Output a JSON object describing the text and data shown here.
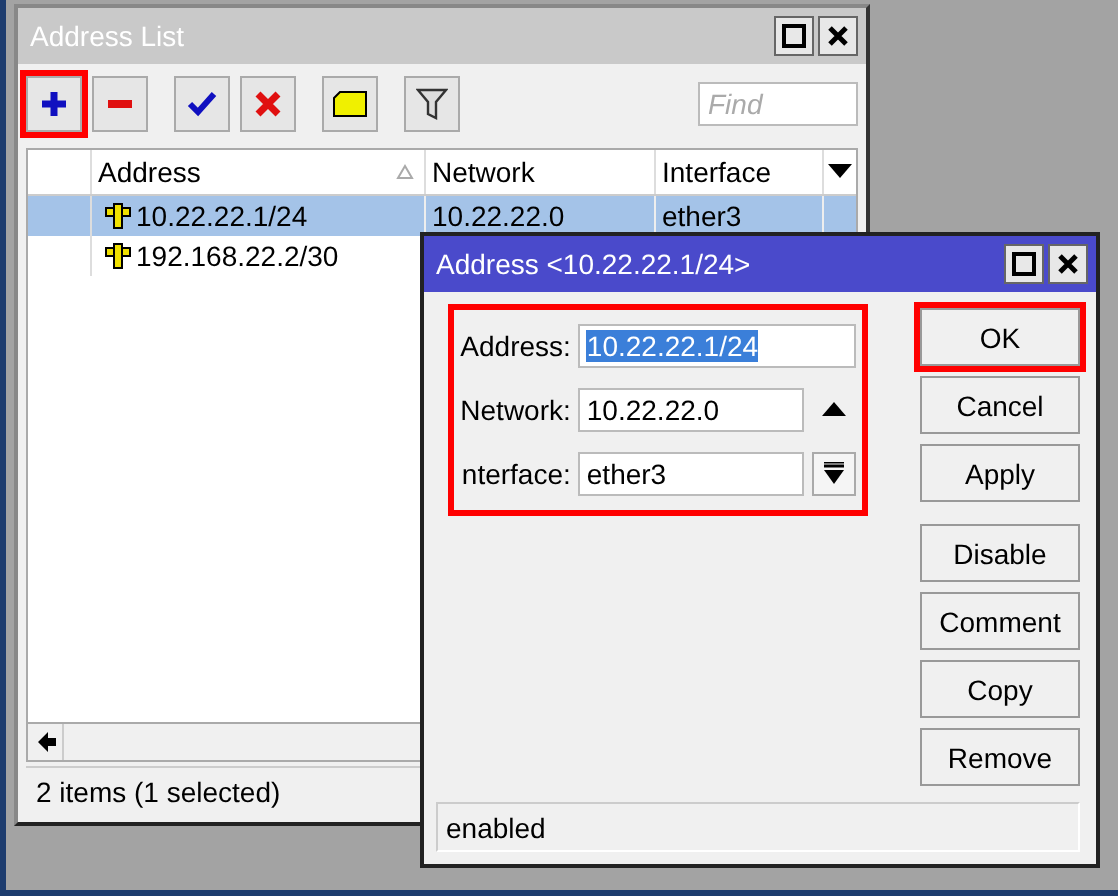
{
  "main_window": {
    "title": "Address List",
    "toolbar": [
      {
        "kind": "add",
        "highlighted": true
      },
      {
        "kind": "remove",
        "highlighted": false
      },
      {
        "kind": "enable",
        "highlighted": false
      },
      {
        "kind": "disable",
        "highlighted": false
      },
      {
        "kind": "comment",
        "highlighted": false
      },
      {
        "kind": "filter",
        "highlighted": false
      }
    ],
    "search": {
      "placeholder": "Find"
    },
    "table": {
      "columns": [
        "Address",
        "Network",
        "Interface"
      ],
      "rows": [
        {
          "address": "10.22.22.1/24",
          "network": "10.22.22.0",
          "interface": "ether3",
          "selected": true
        },
        {
          "address": "192.168.22.2/30",
          "selected": false
        }
      ]
    },
    "status_bar": "2 items (1 selected)"
  },
  "dialog": {
    "title": "Address <10.22.22.1/24>",
    "fields_highlighted": true,
    "fields": [
      {
        "label": "Address:",
        "value": "10.22.22.1/24",
        "text_selected": true,
        "kind": "plain"
      },
      {
        "label": "Network:",
        "value": "10.22.22.0",
        "text_selected": false,
        "kind": "up"
      },
      {
        "label": "nterface:",
        "value": "ether3",
        "text_selected": false,
        "kind": "dropdown"
      }
    ],
    "buttons": [
      {
        "label": "OK",
        "highlighted": true
      },
      {
        "label": "Cancel",
        "highlighted": false
      },
      {
        "label": "Apply",
        "highlighted": false
      },
      {
        "label": "Disable",
        "highlighted": false
      },
      {
        "label": "Comment",
        "highlighted": false
      },
      {
        "label": "Copy",
        "highlighted": false
      },
      {
        "label": "Remove",
        "highlighted": false
      }
    ],
    "status": "enabled"
  }
}
